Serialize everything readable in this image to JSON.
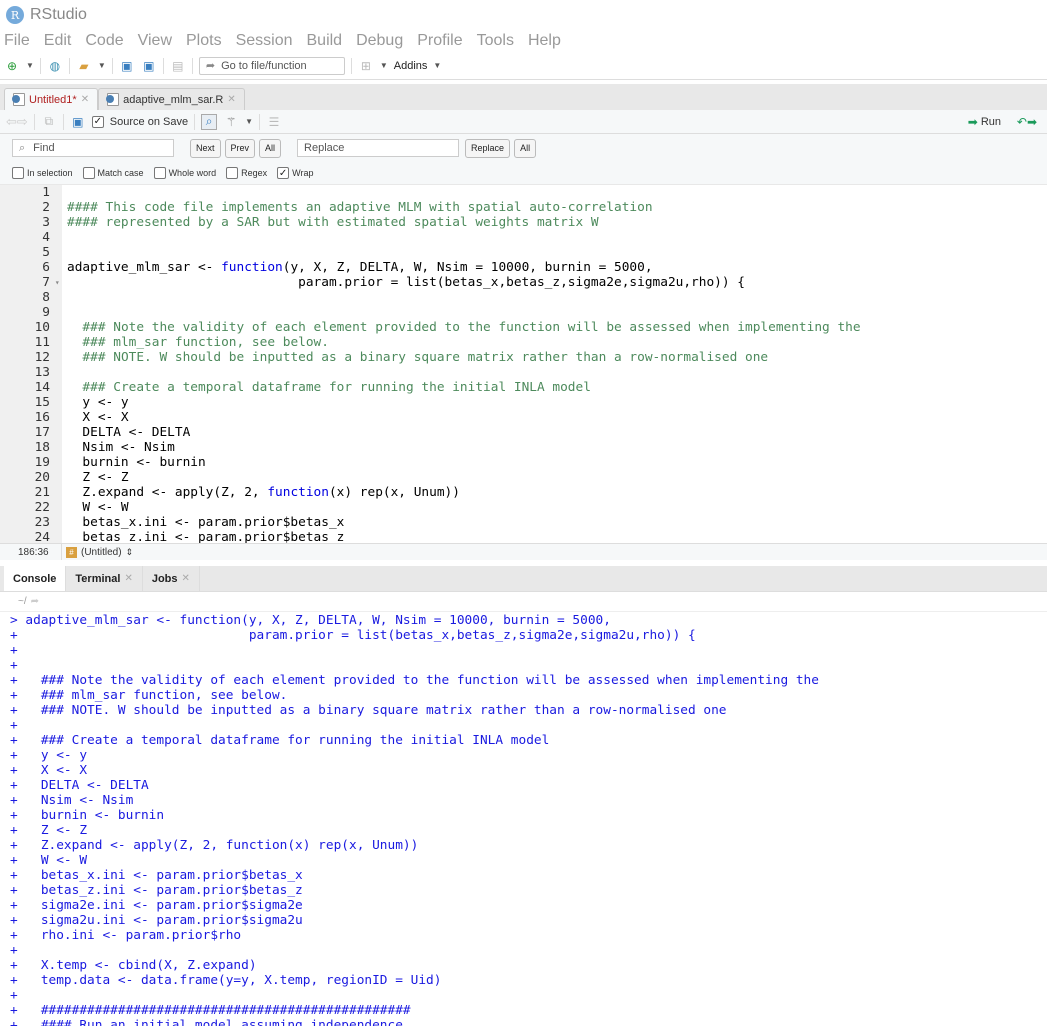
{
  "app": {
    "title": "RStudio"
  },
  "menu": [
    "File",
    "Edit",
    "Code",
    "View",
    "Plots",
    "Session",
    "Build",
    "Debug",
    "Profile",
    "Tools",
    "Help"
  ],
  "toolbar": {
    "goto_placeholder": "Go to file/function",
    "addins": "Addins"
  },
  "source": {
    "tabs": [
      {
        "label": "Untitled1*",
        "active": true
      },
      {
        "label": "adaptive_mlm_sar.R",
        "active": false
      }
    ],
    "source_on_save": "Source on Save",
    "run": "Run",
    "find": {
      "find_placeholder": "Find",
      "next": "Next",
      "prev": "Prev",
      "all": "All",
      "replace_placeholder": "Replace",
      "replace": "Replace",
      "replace_all": "All",
      "options": [
        {
          "label": "In selection",
          "checked": false
        },
        {
          "label": "Match case",
          "checked": false
        },
        {
          "label": "Whole word",
          "checked": false
        },
        {
          "label": "Regex",
          "checked": false
        },
        {
          "label": "Wrap",
          "checked": true
        }
      ]
    },
    "lines": [
      "",
      "#### This code file implements an adaptive MLM with spatial auto-correlation",
      "#### represented by a SAR but with estimated spatial weights matrix W",
      "",
      "",
      "adaptive_mlm_sar <- function(y, X, Z, DELTA, W, Nsim = 10000, burnin = 5000,",
      "                              param.prior = list(betas_x,betas_z,sigma2e,sigma2u,rho)) {",
      "",
      "",
      "  ### Note the validity of each element provided to the function will be assessed when implementing the",
      "  ### mlm_sar function, see below.",
      "  ### NOTE. W should be inputted as a binary square matrix rather than a row-normalised one",
      "",
      "  ### Create a temporal dataframe for running the initial INLA model",
      "  y <- y",
      "  X <- X",
      "  DELTA <- DELTA",
      "  Nsim <- Nsim",
      "  burnin <- burnin",
      "  Z <- Z",
      "  Z.expand <- apply(Z, 2, function(x) rep(x, Unum))",
      "  W <- W",
      "  betas_x.ini <- param.prior$betas_x",
      "  betas_z.ini <- param.prior$betas_z"
    ],
    "status": {
      "position": "186:36",
      "scope": "(Untitled)"
    }
  },
  "console": {
    "tabs": [
      "Console",
      "Terminal",
      "Jobs"
    ],
    "path": "~/",
    "lines": [
      "> adaptive_mlm_sar <- function(y, X, Z, DELTA, W, Nsim = 10000, burnin = 5000,",
      "+                              param.prior = list(betas_x,betas_z,sigma2e,sigma2u,rho)) {",
      "+ ",
      "+ ",
      "+   ### Note the validity of each element provided to the function will be assessed when implementing the",
      "+   ### mlm_sar function, see below.",
      "+   ### NOTE. W should be inputted as a binary square matrix rather than a row-normalised one",
      "+ ",
      "+   ### Create a temporal dataframe for running the initial INLA model",
      "+   y <- y",
      "+   X <- X",
      "+   DELTA <- DELTA",
      "+   Nsim <- Nsim",
      "+   burnin <- burnin",
      "+   Z <- Z",
      "+   Z.expand <- apply(Z, 2, function(x) rep(x, Unum))",
      "+   W <- W",
      "+   betas_x.ini <- param.prior$betas_x",
      "+   betas_z.ini <- param.prior$betas_z",
      "+   sigma2e.ini <- param.prior$sigma2e",
      "+   sigma2u.ini <- param.prior$sigma2u",
      "+   rho.ini <- param.prior$rho",
      "+ ",
      "+   X.temp <- cbind(X, Z.expand)",
      "+   temp.data <- data.frame(y=y, X.temp, regionID = Uid)",
      "+ ",
      "+   ################################################",
      "+   #### Run an initial model assuming independence"
    ]
  }
}
